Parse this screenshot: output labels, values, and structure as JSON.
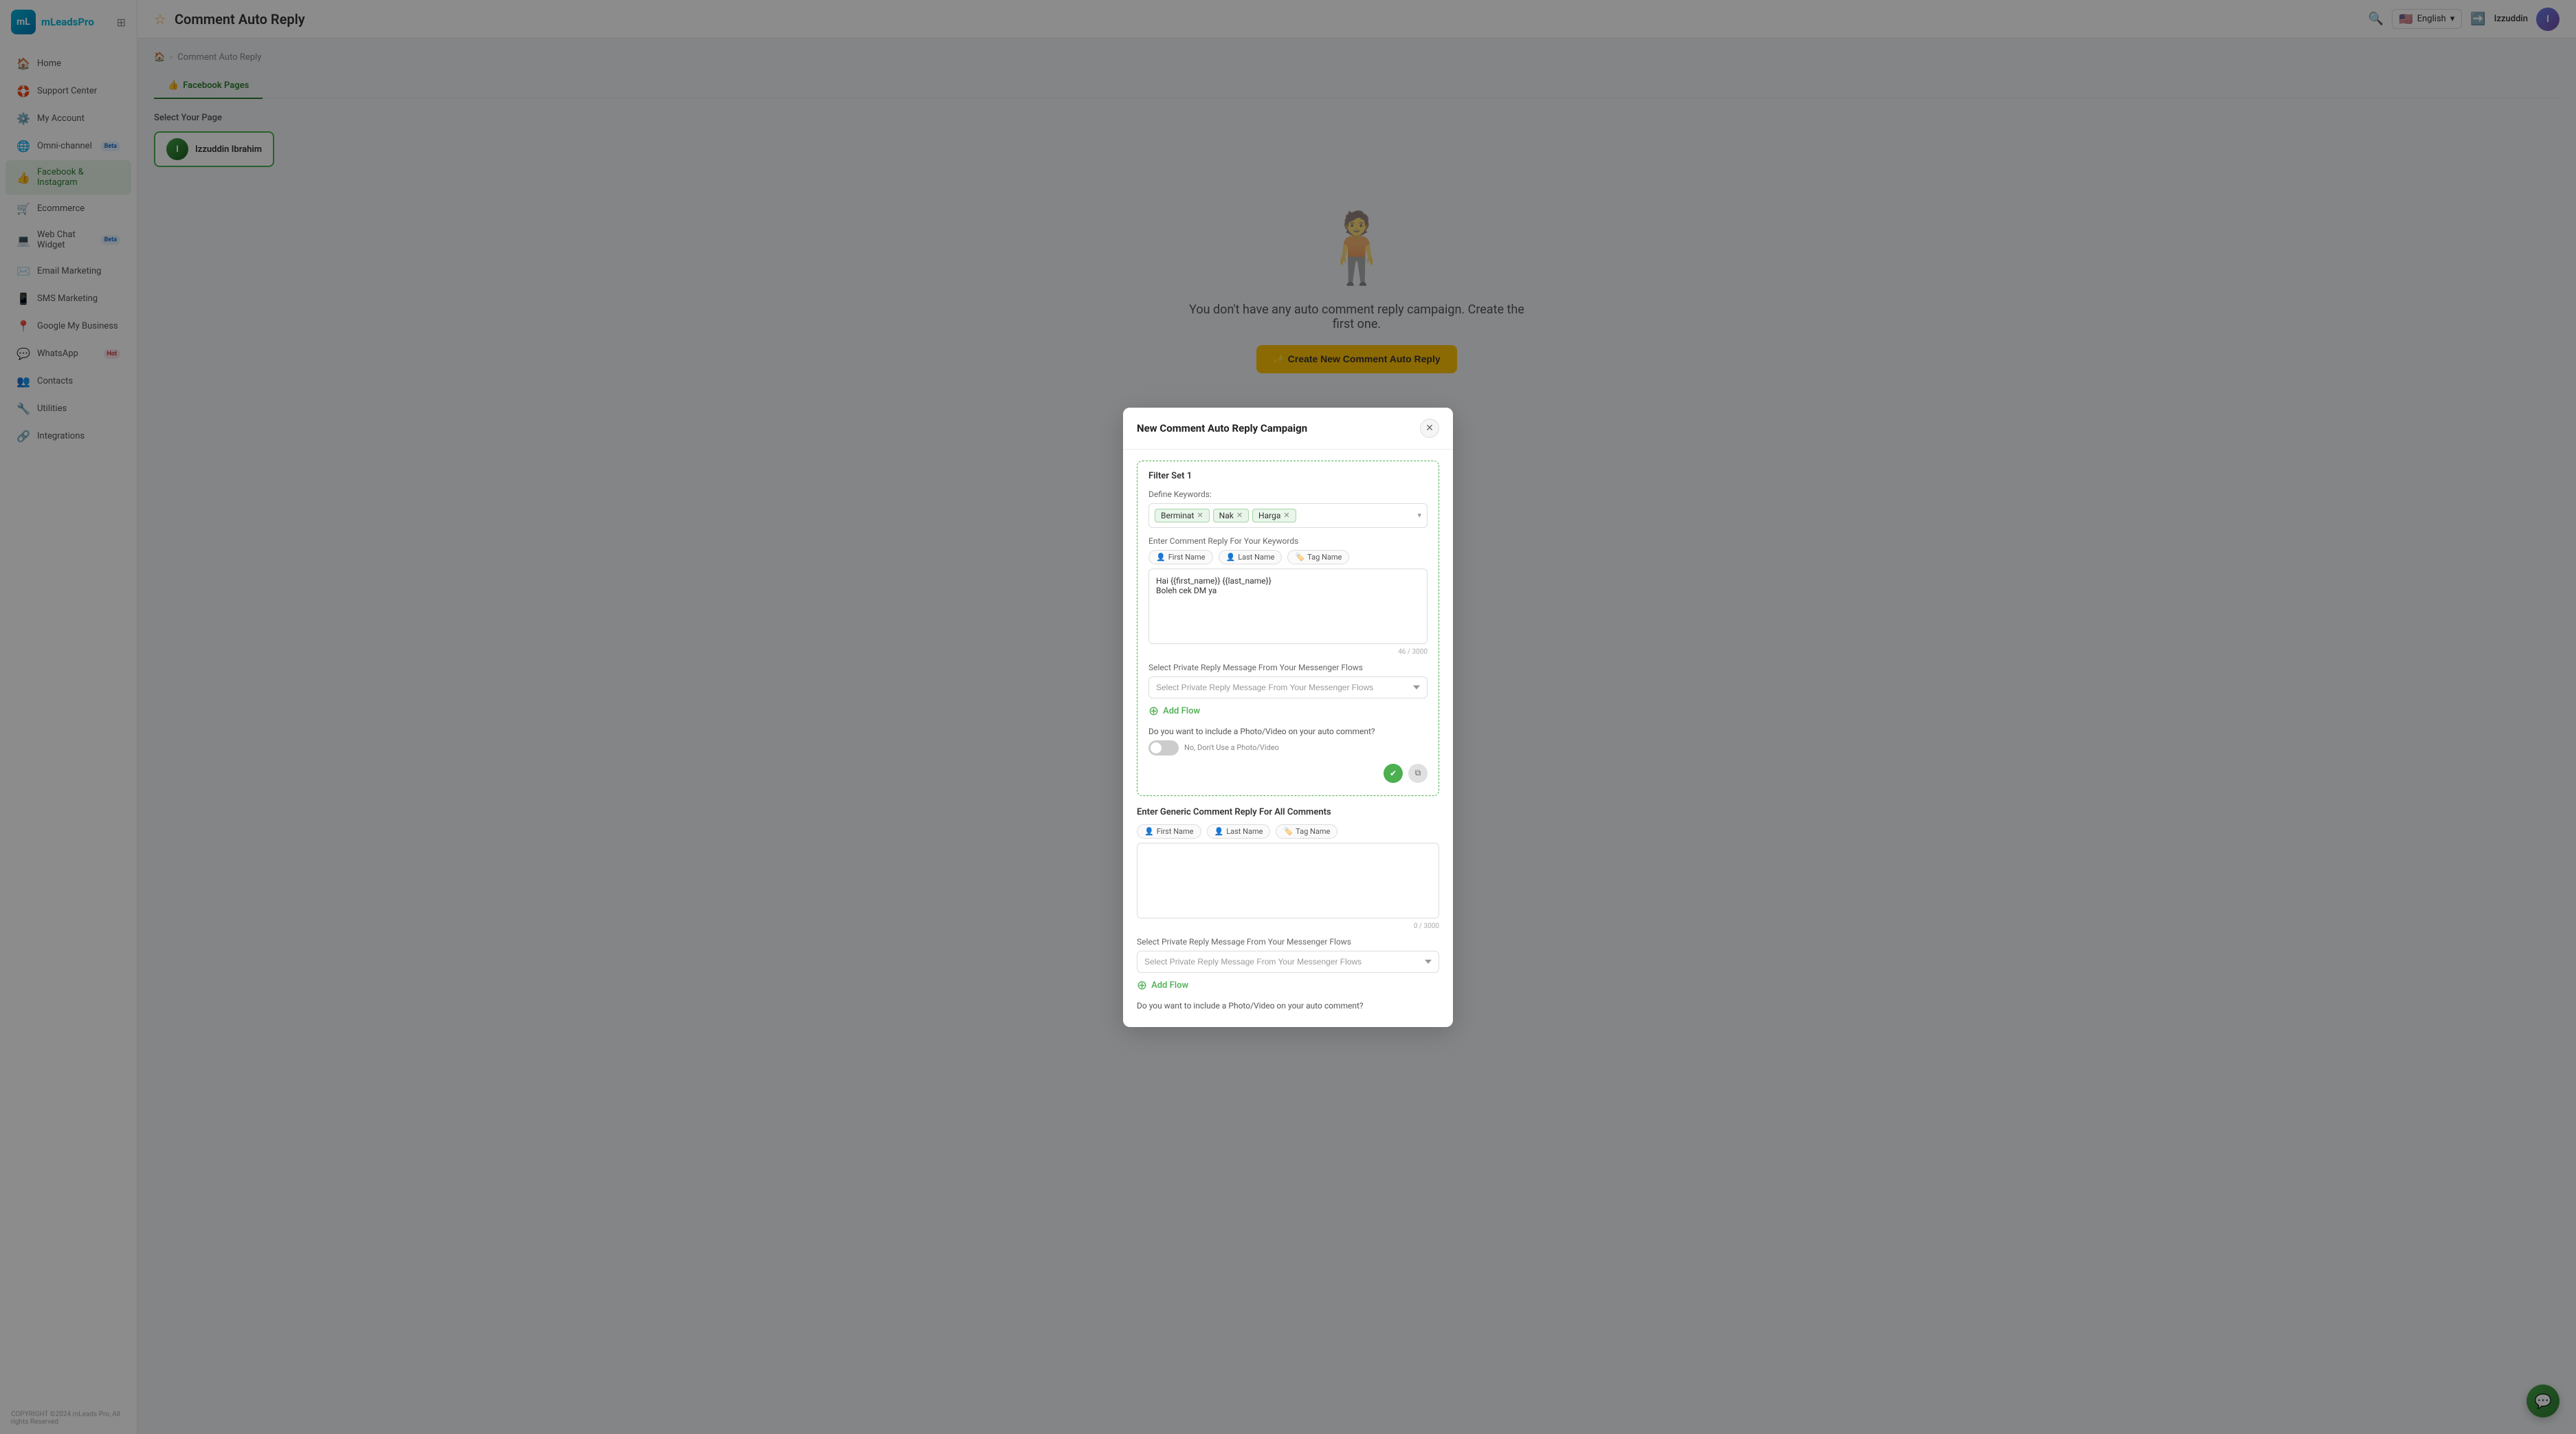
{
  "brand": {
    "name": "mLeadsPro",
    "initials": "mL"
  },
  "topbar": {
    "title": "Comment Auto Reply",
    "user_name": "Izzuddin",
    "language": "English",
    "language_flag": "🇺🇸"
  },
  "sidebar": {
    "items": [
      {
        "id": "home",
        "icon": "🏠",
        "label": "Home",
        "badge": null,
        "active": false
      },
      {
        "id": "support",
        "icon": "🛟",
        "label": "Support Center",
        "badge": null,
        "active": false
      },
      {
        "id": "my-account",
        "icon": "⚙️",
        "label": "My Account",
        "badge": null,
        "active": false
      },
      {
        "id": "omni-channel",
        "icon": "🌐",
        "label": "Omni-channel",
        "badge": "Beta",
        "badge_type": "beta",
        "active": false
      },
      {
        "id": "facebook-instagram",
        "icon": "👍",
        "label": "Facebook & Instagram",
        "badge": null,
        "active": true
      },
      {
        "id": "ecommerce",
        "icon": "🛒",
        "label": "Ecommerce",
        "badge": null,
        "active": false
      },
      {
        "id": "web-chat",
        "icon": "💻",
        "label": "Web Chat Widget",
        "badge": "Beta",
        "badge_type": "beta",
        "active": false
      },
      {
        "id": "email-marketing",
        "icon": "✉️",
        "label": "Email Marketing",
        "badge": null,
        "active": false
      },
      {
        "id": "sms-marketing",
        "icon": "📱",
        "label": "SMS Marketing",
        "badge": null,
        "active": false
      },
      {
        "id": "google-my-business",
        "icon": "📍",
        "label": "Google My Business",
        "badge": null,
        "active": false
      },
      {
        "id": "whatsapp",
        "icon": "💬",
        "label": "WhatsApp",
        "badge": "Hot",
        "badge_type": "hot",
        "active": false
      },
      {
        "id": "contacts",
        "icon": "👥",
        "label": "Contacts",
        "badge": null,
        "active": false
      },
      {
        "id": "utilities",
        "icon": "🔧",
        "label": "Utilities",
        "badge": null,
        "active": false
      },
      {
        "id": "integrations",
        "icon": "🔗",
        "label": "Integrations",
        "badge": null,
        "active": false
      }
    ],
    "footer": "COPYRIGHT ©2024 mLeads Pro, All rights Reserved"
  },
  "page": {
    "tab_active": "Facebook Pages",
    "tabs": [
      "Facebook Pages"
    ],
    "select_page_label": "Select Your Page",
    "page_name": "Izzuddin Ibrahim",
    "page_initials": "I"
  },
  "empty_state": {
    "text": "You don't have any auto comment reply campaign. Create the first one.",
    "create_btn_label": "✨ Create New Comment Auto Reply"
  },
  "modal": {
    "title": "New Comment Auto Reply Campaign",
    "close_label": "✕",
    "filter_set": {
      "title": "Filter Set 1",
      "keywords_label": "Define Keywords:",
      "keywords": [
        "Berminat",
        "Nak",
        "Harga"
      ],
      "reply_label": "Enter Comment Reply For Your Keywords",
      "insert_first_name": "First Name",
      "insert_last_name": "Last Name",
      "insert_tag_name": "Tag Name",
      "reply_text": "Hai {{first_name}} {{last_name}}\nBoleh cek DM ya",
      "char_count": "46 / 3000",
      "select_flow_placeholder": "Select Private Reply Message From Your Messenger Flows",
      "add_flow_label": "Add Flow",
      "photo_video_label": "Do you want to include a Photo/Video on your auto comment?",
      "toggle_label": "No, Don't Use a Photo/Video"
    },
    "generic_section": {
      "title": "Enter Generic Comment Reply For All Comments",
      "insert_first_name": "First Name",
      "insert_last_name": "Last Name",
      "insert_tag_name": "Tag Name",
      "reply_text": "",
      "char_count": "0 / 3000",
      "select_flow_placeholder": "Select Private Reply Message From Your Messenger Flows",
      "add_flow_label": "Add Flow",
      "photo_video_label": "Do you want to include a Photo/Video on your auto comment?"
    }
  },
  "colors": {
    "brand_green": "#4caf50",
    "dark_green": "#2e7d32",
    "brand_blue": "#00b4d8",
    "yellow": "#ffc107"
  }
}
